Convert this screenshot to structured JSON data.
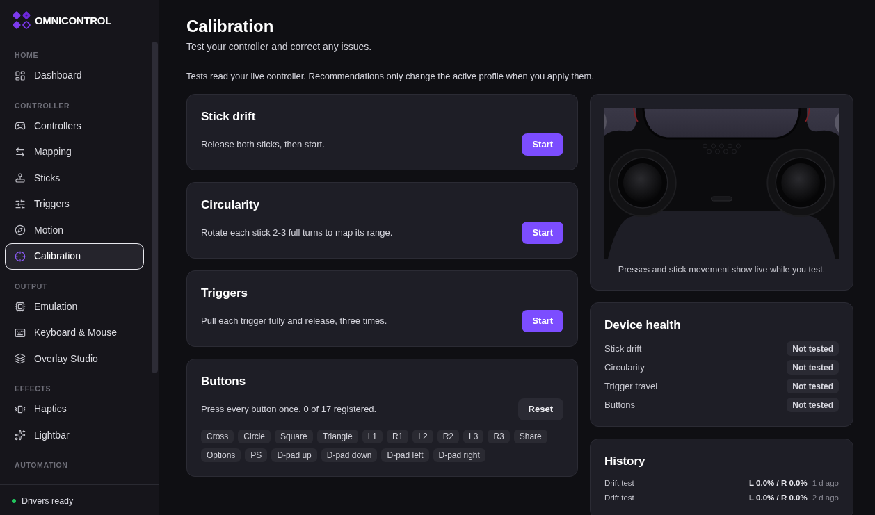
{
  "sidebar": {
    "logo": "OMNICONTROL",
    "sections": [
      {
        "heading": "HOME",
        "items": [
          {
            "label": "Dashboard",
            "selected": false
          }
        ]
      },
      {
        "heading": "CONTROLLER",
        "items": [
          {
            "label": "Controllers",
            "selected": false
          },
          {
            "label": "Mapping",
            "selected": false
          },
          {
            "label": "Sticks",
            "selected": false
          },
          {
            "label": "Triggers",
            "selected": false
          },
          {
            "label": "Motion",
            "selected": false
          },
          {
            "label": "Calibration",
            "selected": true
          }
        ]
      },
      {
        "heading": "OUTPUT",
        "items": [
          {
            "label": "Emulation",
            "selected": false
          },
          {
            "label": "Keyboard & Mouse",
            "selected": false
          },
          {
            "label": "Overlay Studio",
            "selected": false
          }
        ]
      },
      {
        "heading": "EFFECTS",
        "items": [
          {
            "label": "Haptics",
            "selected": false
          },
          {
            "label": "Lightbar",
            "selected": false
          }
        ]
      },
      {
        "heading": "AUTOMATION"
      }
    ],
    "status": "Drivers ready"
  },
  "page": {
    "title": "Calibration",
    "subtitle": "Test your controller and correct any issues.",
    "note": "Tests read your live controller. Recommendations only change the active profile when you apply them."
  },
  "tests": [
    {
      "title": "Stick drift",
      "description": "Release both sticks, then start.",
      "button": "Start",
      "kind": "primary"
    },
    {
      "title": "Circularity",
      "description": "Rotate each stick 2-3 full turns to map its range.",
      "button": "Start",
      "kind": "primary"
    },
    {
      "title": "Triggers",
      "description": "Pull each trigger fully and release, three times.",
      "button": "Start",
      "kind": "primary"
    },
    {
      "title": "Buttons",
      "description": "Press every button once. 0 of 17 registered.",
      "button": "Reset",
      "kind": "secondary",
      "chips": [
        "Cross",
        "Circle",
        "Square",
        "Triangle",
        "L1",
        "R1",
        "L2",
        "R2",
        "L3",
        "R3",
        "Share",
        "Options",
        "PS",
        "D-pad up",
        "D-pad down",
        "D-pad left",
        "D-pad right"
      ]
    }
  ],
  "preview": {
    "caption": "Presses and stick movement show live while you test."
  },
  "health": {
    "title": "Device health",
    "rows": [
      {
        "label": "Stick drift",
        "status": "Not tested"
      },
      {
        "label": "Circularity",
        "status": "Not tested"
      },
      {
        "label": "Trigger travel",
        "status": "Not tested"
      },
      {
        "label": "Buttons",
        "status": "Not tested"
      }
    ]
  },
  "history": {
    "title": "History",
    "rows": [
      {
        "label": "Drift test",
        "result": "L 0.0% / R 0.0%",
        "time": "1 d ago"
      },
      {
        "label": "Drift test",
        "result": "L 0.0% / R 0.0%",
        "time": "2 d ago"
      }
    ]
  }
}
